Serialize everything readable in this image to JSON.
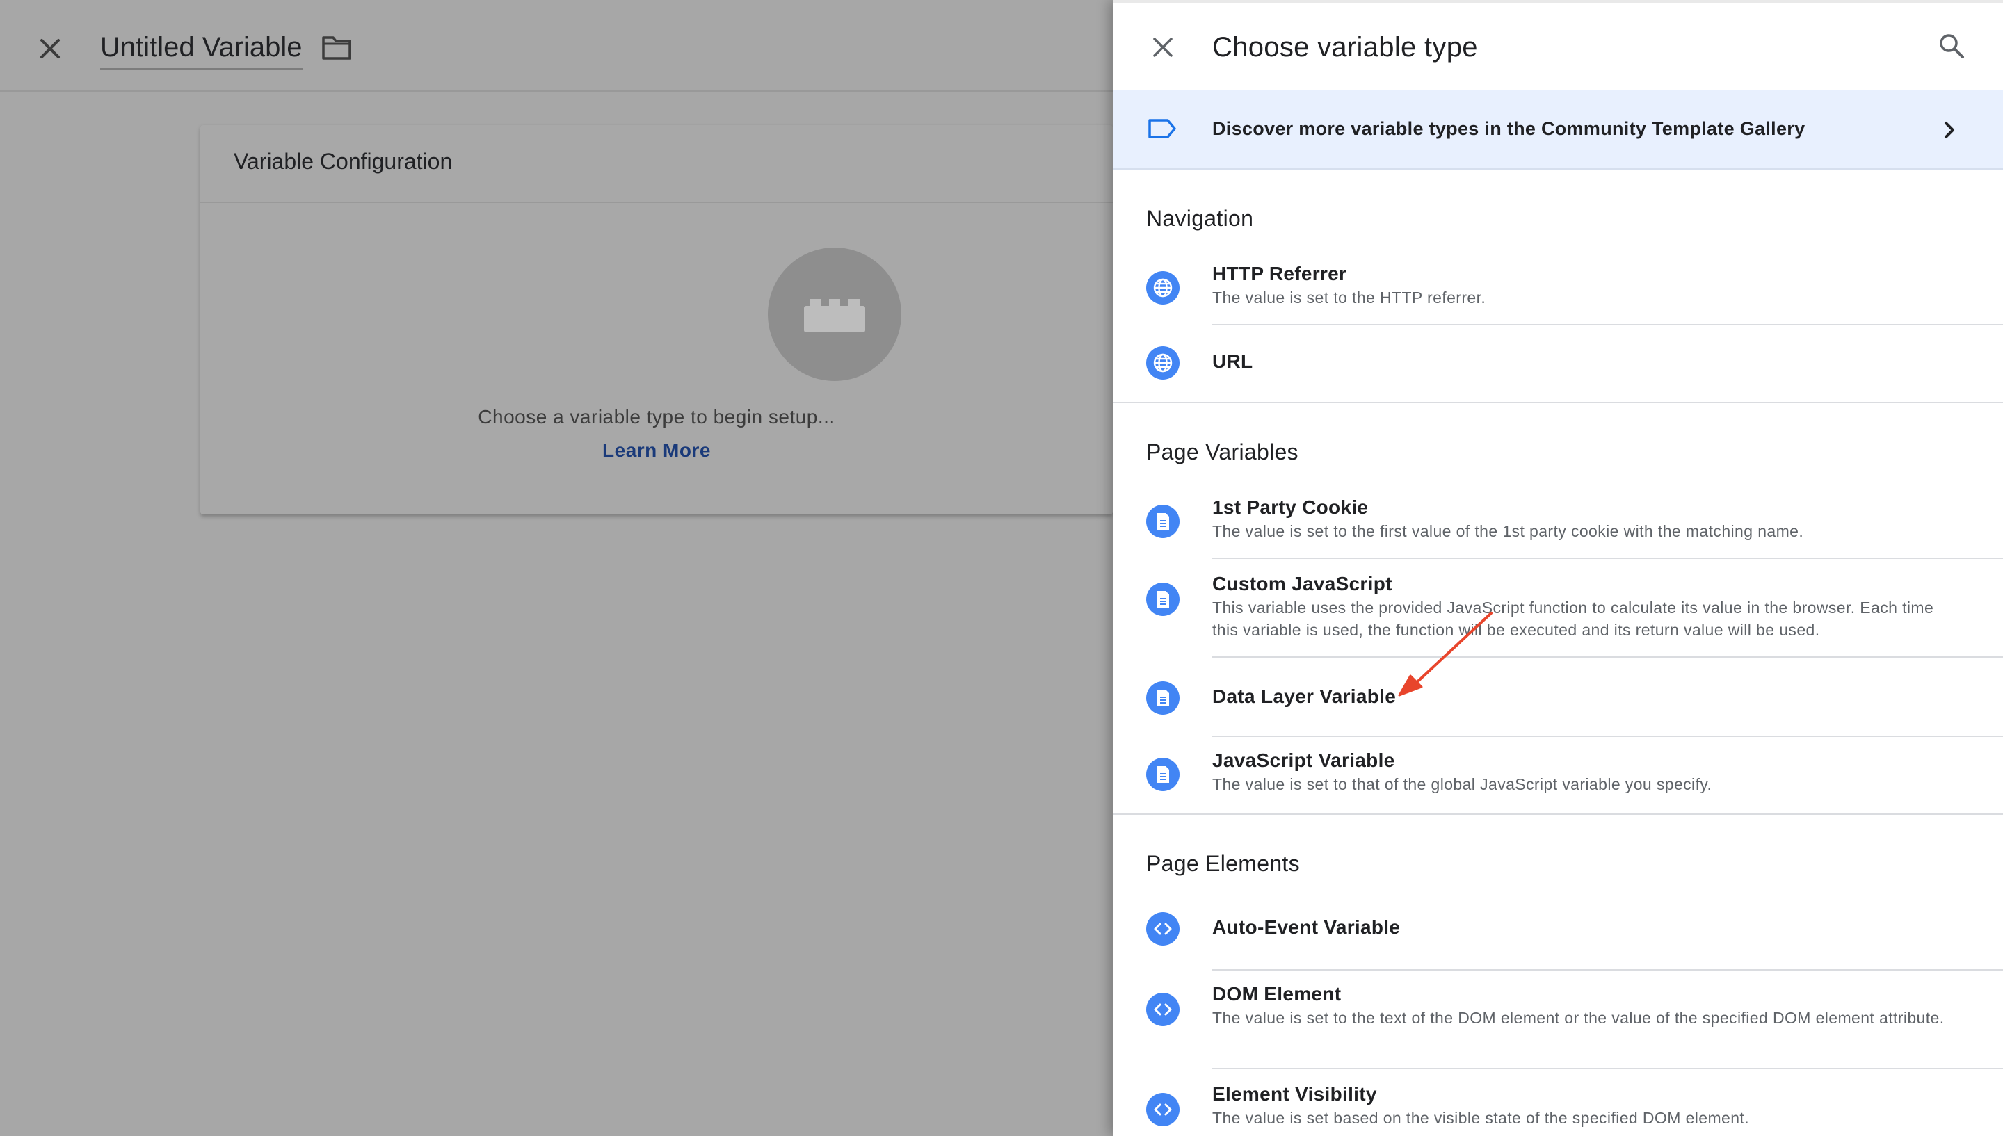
{
  "editor": {
    "title": "Untitled Variable",
    "close_icon": "close-icon",
    "folder_icon": "folder-icon",
    "config_card": {
      "title": "Variable Configuration",
      "prompt": "Choose a variable type to begin setup...",
      "learn_more": "Learn More",
      "icon": "block-icon"
    }
  },
  "panel": {
    "title": "Choose variable type",
    "close_icon": "close-icon",
    "search_icon": "search-icon",
    "gallery": {
      "text": "Discover more variable types in the Community Template Gallery",
      "icon": "tag-icon",
      "chevron": "chevron-right-icon"
    },
    "sections": [
      {
        "title": "Navigation",
        "items": [
          {
            "name": "HTTP Referrer",
            "desc": "The value is set to the HTTP referrer.",
            "icon": "globe-icon"
          },
          {
            "name": "URL",
            "desc": "",
            "icon": "globe-icon"
          }
        ]
      },
      {
        "title": "Page Variables",
        "items": [
          {
            "name": "1st Party Cookie",
            "desc": "The value is set to the first value of the 1st party cookie with the matching name.",
            "icon": "document-icon"
          },
          {
            "name": "Custom JavaScript",
            "desc": "This variable uses the provided JavaScript function to calculate its value in the browser. Each time this variable is used, the function will be executed and its return value will be used.",
            "icon": "document-icon"
          },
          {
            "name": "Data Layer Variable",
            "desc": "",
            "icon": "document-icon"
          },
          {
            "name": "JavaScript Variable",
            "desc": "The value is set to that of the global JavaScript variable you specify.",
            "icon": "document-icon"
          }
        ]
      },
      {
        "title": "Page Elements",
        "items": [
          {
            "name": "Auto-Event Variable",
            "desc": "",
            "icon": "code-icon"
          },
          {
            "name": "DOM Element",
            "desc": "The value is set to the text of the DOM element or the value of the specified DOM element attribute.",
            "icon": "code-icon"
          },
          {
            "name": "Element Visibility",
            "desc": "The value is set based on the visible state of the specified DOM element.",
            "icon": "code-icon"
          }
        ]
      }
    ]
  },
  "annotation": {
    "arrow_color": "#e8452c",
    "points_to": "Data Layer Variable"
  },
  "colors": {
    "accent": "#4285f4",
    "banner_bg": "#e8f0fe",
    "dim_overlay": "#a7a7a7",
    "link": "#1a3a7a"
  }
}
